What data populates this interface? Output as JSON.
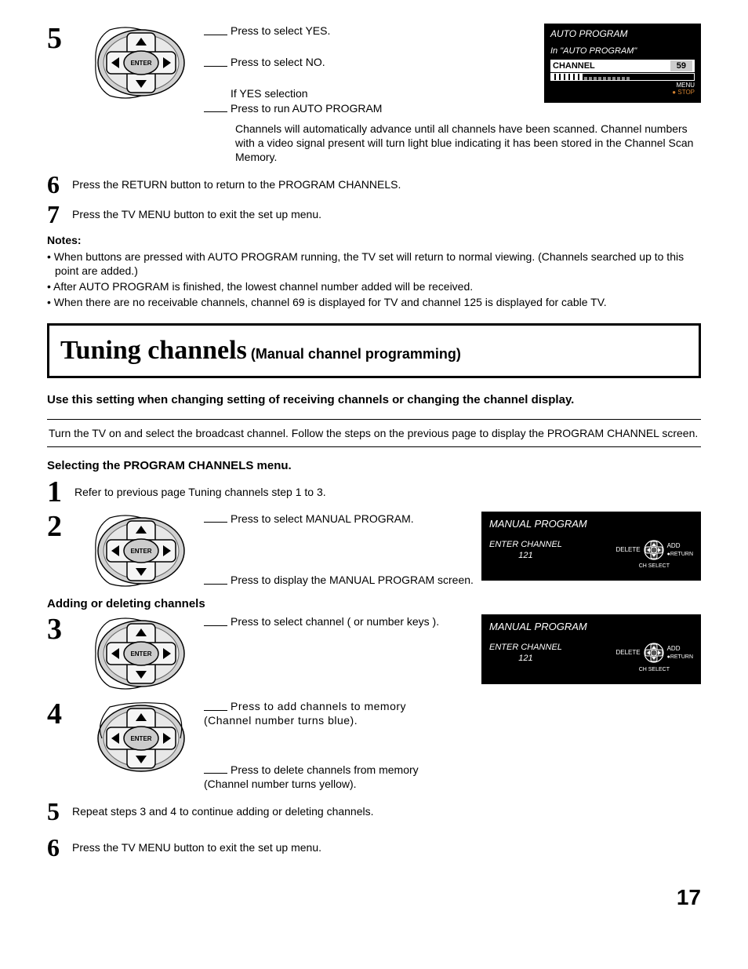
{
  "enter_label": "ENTER",
  "step5": {
    "num": "5",
    "line_up": "Press to select YES.",
    "line_right": "Press to select NO.",
    "line_if": "If YES selection",
    "line_down": "Press to run AUTO PROGRAM"
  },
  "auto_osd": {
    "title": "AUTO PROGRAM",
    "status": "In \"AUTO PROGRAM\"",
    "channel_label": "CHANNEL",
    "channel_value": "59",
    "foot_menu": "MENU",
    "foot_stop": "STOP"
  },
  "auto_note": "Channels will automatically advance until all channels have been scanned. Channel numbers with a video signal present will turn light blue indicating it has been stored in the Channel Scan Memory.",
  "step6": {
    "num": "6",
    "text": "Press the RETURN button to return to the PROGRAM CHANNELS."
  },
  "step7": {
    "num": "7",
    "text": "Press the TV MENU button to exit the set up menu."
  },
  "notes_title": "Notes:",
  "notes": [
    "When buttons are pressed with AUTO PROGRAM running, the TV set will return to normal viewing. (Channels searched up to this point are added.)",
    "After AUTO PROGRAM is finished, the lowest channel number added will be received.",
    "When there are no receivable channels, channel 69 is displayed for TV and channel 125 is displayed for cable TV."
  ],
  "section": {
    "title": "Tuning channels",
    "sub": " (Manual channel programming)"
  },
  "intro_bold": "Use this setting when changing setting of receiving channels or changing the channel display.",
  "hr_text": "Turn the TV on and select the broadcast channel. Follow the steps on the previous page to display the PROGRAM CHANNEL screen.",
  "subhead1": "Selecting the PROGRAM CHANNELS menu.",
  "m_step1": {
    "num": "1",
    "text": "Refer to previous page Tuning channels step 1 to 3."
  },
  "m_step2": {
    "num": "2",
    "line_up": "Press to select MANUAL PROGRAM.",
    "line_down": "Press to display the MANUAL PROGRAM screen."
  },
  "manual_osd": {
    "title": "MANUAL PROGRAM",
    "enter": "ENTER CHANNEL",
    "value": "121",
    "delete": "DELETE",
    "add": "ADD",
    "return": "RETURN",
    "chselect": "CH SELECT"
  },
  "subhead2": "Adding or deleting channels",
  "m_step3": {
    "num": "3",
    "text": "Press to select channel ( or number keys )."
  },
  "m_step4": {
    "num": "4",
    "line_right": "Press to add channels to memory (Channel number turns blue).",
    "line_left": "Press to delete channels from memory (Channel number turns yellow)."
  },
  "m_step5": {
    "num": "5",
    "text": "Repeat steps 3 and 4 to continue adding or deleting channels."
  },
  "m_step6": {
    "num": "6",
    "text": "Press the TV MENU button to exit the set up menu."
  },
  "page_number": "17"
}
